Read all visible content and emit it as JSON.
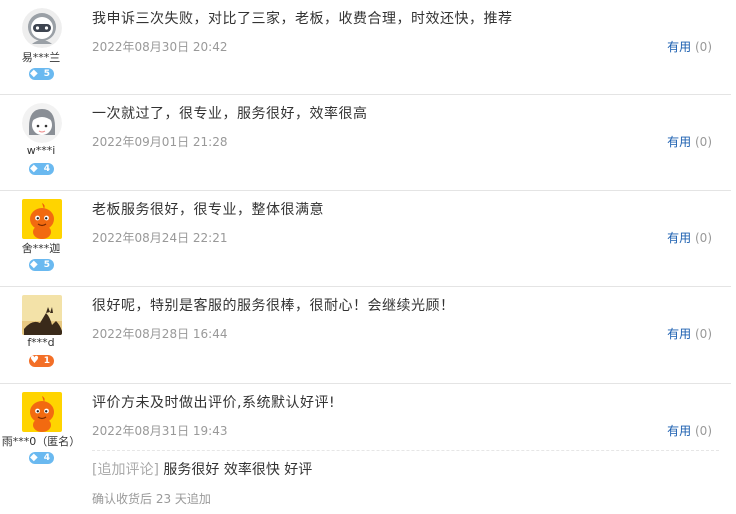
{
  "useful_label": "有用",
  "reviews": [
    {
      "username": "易***兰",
      "level": "5",
      "level_type": "diamond",
      "content": "我申诉三次失败，对比了三家，老板，收费合理，时效还快，推荐",
      "date": "2022年08月30日 20:42",
      "useful_count": "(0)"
    },
    {
      "username": "w***i",
      "level": "4",
      "level_type": "diamond",
      "content": "一次就过了，很专业，服务很好，效率很高",
      "date": "2022年09月01日 21:28",
      "useful_count": "(0)"
    },
    {
      "username": "舍***迦",
      "level": "5",
      "level_type": "diamond",
      "content": "老板服务很好，很专业，整体很满意",
      "date": "2022年08月24日 22:21",
      "useful_count": "(0)"
    },
    {
      "username": "f***d",
      "level": "1",
      "level_type": "heart",
      "content": "很好呢，特别是客服的服务很棒，很耐心！会继续光顾！",
      "date": "2022年08月28日 16:44",
      "useful_count": "(0)"
    },
    {
      "username": "雨***0（匿名）",
      "level": "4",
      "level_type": "diamond",
      "content": "评价方未及时做出评价,系统默认好评!",
      "date": "2022年08月31日 19:43",
      "useful_count": "(0)",
      "append_tag": "[追加评论]",
      "append_content": "服务很好 效率很快 好评",
      "append_note": "确认收货后 23 天追加"
    }
  ]
}
